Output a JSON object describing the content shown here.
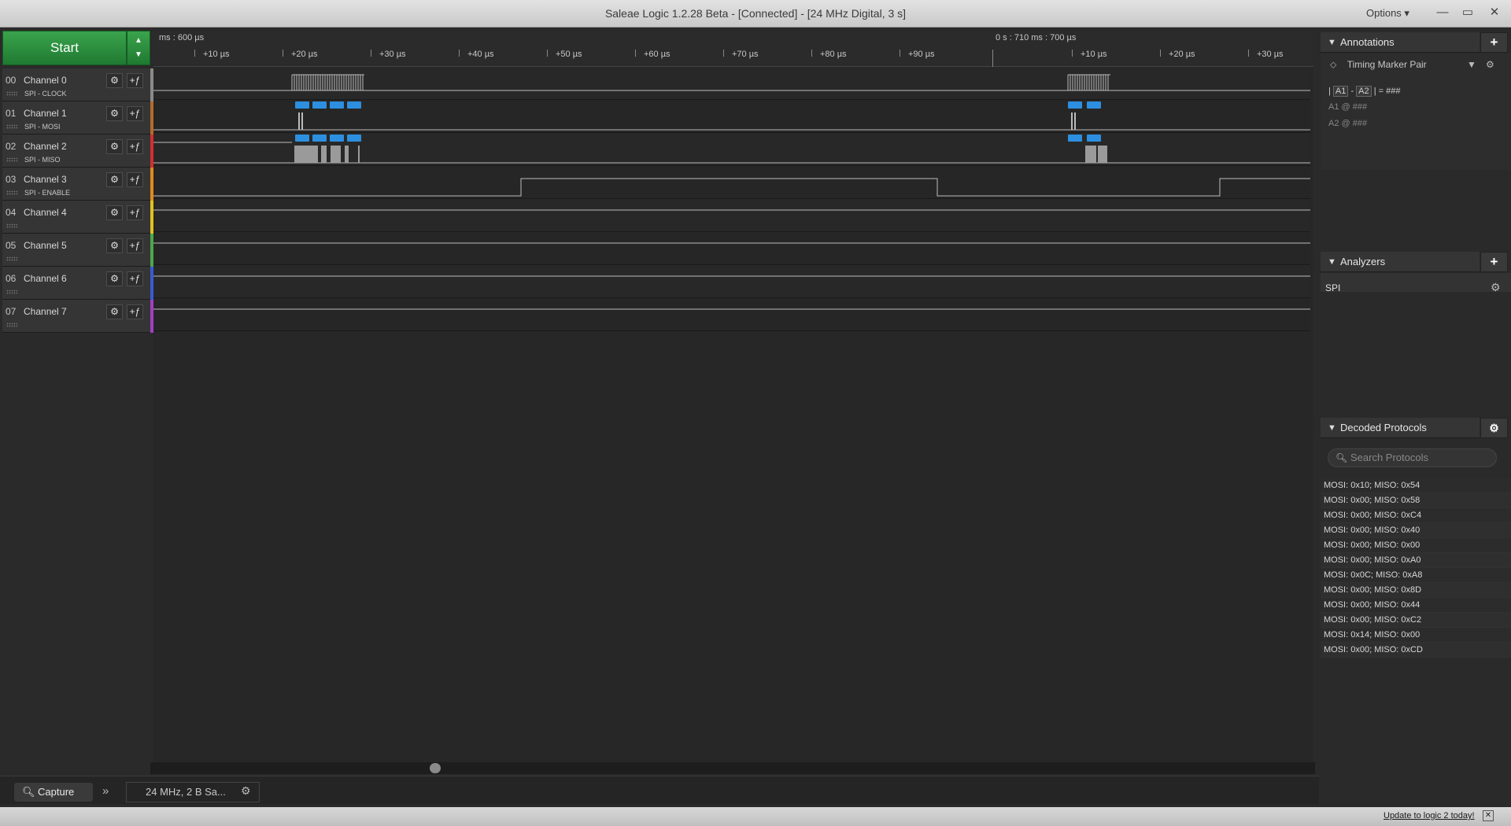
{
  "window": {
    "title": "Saleae Logic 1.2.28 Beta - [Connected] - [24 MHz Digital, 3 s]",
    "options_label": "Options ▾",
    "minimize": "—",
    "maximize": "▭",
    "close": "✕"
  },
  "toolbar": {
    "start_label": "Start",
    "start_up": "▲",
    "start_down": "▼"
  },
  "time_header": {
    "left_origin": "ms : 600 µs",
    "right_origin": "0 s : 710 ms : 700 µs",
    "ticks_left": [
      "+10 µs",
      "+20 µs",
      "+30 µs",
      "+40 µs",
      "+50 µs",
      "+60 µs",
      "+70 µs",
      "+80 µs",
      "+90 µs"
    ],
    "ticks_right": [
      "+10 µs",
      "+20 µs",
      "+30 µs"
    ]
  },
  "channels": [
    {
      "num": "00",
      "name": "Channel 0",
      "sub": "SPI - CLOCK",
      "color": "#8a8a8a"
    },
    {
      "num": "01",
      "name": "Channel 1",
      "sub": "SPI - MOSI",
      "color": "#b46a2a"
    },
    {
      "num": "02",
      "name": "Channel 2",
      "sub": "SPI - MISO",
      "color": "#d03030"
    },
    {
      "num": "03",
      "name": "Channel 3",
      "sub": "SPI - ENABLE",
      "color": "#e08a20"
    },
    {
      "num": "04",
      "name": "Channel 4",
      "sub": "",
      "color": "#e0c020"
    },
    {
      "num": "05",
      "name": "Channel 5",
      "sub": "",
      "color": "#4aa84a"
    },
    {
      "num": "06",
      "name": "Channel 6",
      "sub": "",
      "color": "#3a5ad0"
    },
    {
      "num": "07",
      "name": "Channel 7",
      "sub": "",
      "color": "#a040c0"
    }
  ],
  "bottom_bar": {
    "capture_label": "Capture",
    "rate_label": "24 MHz, 2 B Sa...",
    "expand_icon": "»"
  },
  "status_bar": {
    "update_label": "Update to logic 2 today!",
    "close": "✕"
  },
  "sidebar": {
    "annotations": {
      "title": "Annotations",
      "add": "+",
      "marker_pair": "Timing Marker Pair",
      "a1": "A1",
      "a2": "A2",
      "diff_text": "= ###",
      "a1_row": "A1  @  ###",
      "a2_row": "A2  @  ###"
    },
    "analyzers": {
      "title": "Analyzers",
      "add": "+",
      "items": [
        "SPI"
      ]
    },
    "decoded": {
      "title": "Decoded Protocols",
      "search_placeholder": "Search Protocols",
      "rows": [
        "MOSI: 0x10;  MISO: 0x54",
        "MOSI: 0x00;  MISO: 0x58",
        "MOSI: 0x00;  MISO: 0xC4",
        "MOSI: 0x00;  MISO: 0x40",
        "MOSI: 0x00;  MISO: 0x00",
        "MOSI: 0x00;  MISO: 0xA0",
        "MOSI: 0x0C;  MISO: 0xA8",
        "MOSI: 0x00;  MISO: 0x8D",
        "MOSI: 0x00;  MISO: 0x44",
        "MOSI: 0x00;  MISO: 0xC2",
        "MOSI: 0x14;  MISO: 0x00",
        "MOSI: 0x00;  MISO: 0xCD"
      ]
    }
  },
  "accent_colors": {
    "start_green": "#2a8f3e",
    "decode_blue": "#2d8fe0",
    "wave_gray": "#bcbcbc"
  }
}
